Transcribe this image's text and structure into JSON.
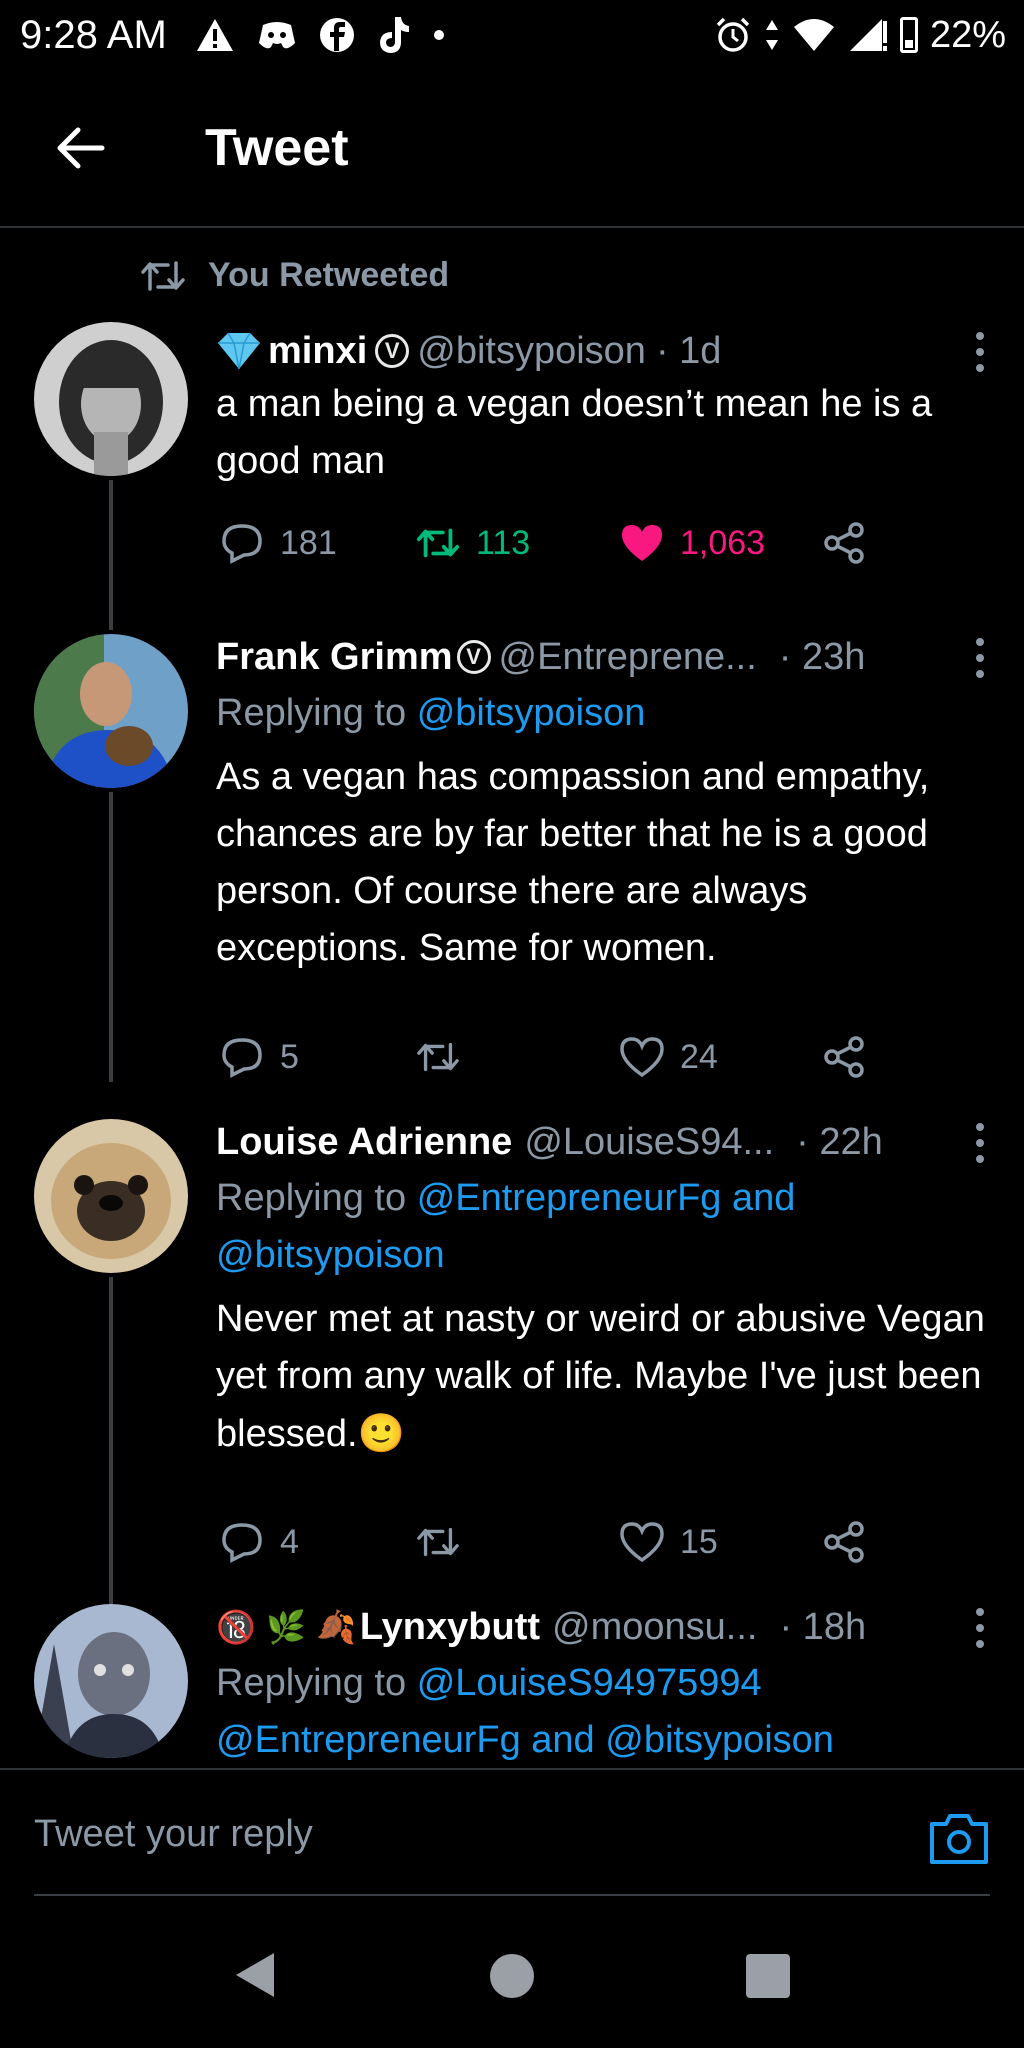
{
  "status_bar": {
    "time": "9:28 AM",
    "battery": "22%"
  },
  "header": {
    "title": "Tweet"
  },
  "retweet_label": "You Retweeted",
  "tweets": [
    {
      "name": "minxi",
      "handle": "@bitsypoison",
      "time": "· 1d",
      "text": "a man being a vegan doesn’t mean he is a good man",
      "replies": "181",
      "retweets": "113",
      "likes": "1,063"
    },
    {
      "name": "Frank Grimm",
      "handle": "@Entreprene...",
      "time": "· 23h",
      "reply_prefix": "Replying to",
      "reply_to": "@bitsypoison",
      "text": "As a vegan has compassion and empathy, chances are by far better that he is a good person. Of course there are always exceptions. Same for women.",
      "replies": "5",
      "likes": "24"
    },
    {
      "name": "Louise Adrienne",
      "handle": "@LouiseS94...",
      "time": "· 22h",
      "reply_prefix": "Replying to",
      "reply_to": "@EntrepreneurFg and @bitsypoison",
      "text": "Never met at nasty or weird or abusive Vegan yet from any walk of life. Maybe I've just been blessed.",
      "text_emoji": "🙂",
      "replies": "4",
      "likes": "15"
    },
    {
      "name_prefix": "🔞 🌿 🍂",
      "name": "Lynxybutt",
      "handle": "@moonsu...",
      "time": "· 18h",
      "reply_prefix": "Replying to",
      "reply_to": "@LouiseS94975994 @EntrepreneurFg and @bitsypoison"
    }
  ],
  "reply_bar": {
    "placeholder": "Tweet your reply"
  },
  "colors": {
    "background": "#000000",
    "link": "#1d9bf0",
    "retweet": "#00ba7c",
    "like": "#f91880",
    "muted": "#8b98a5"
  }
}
